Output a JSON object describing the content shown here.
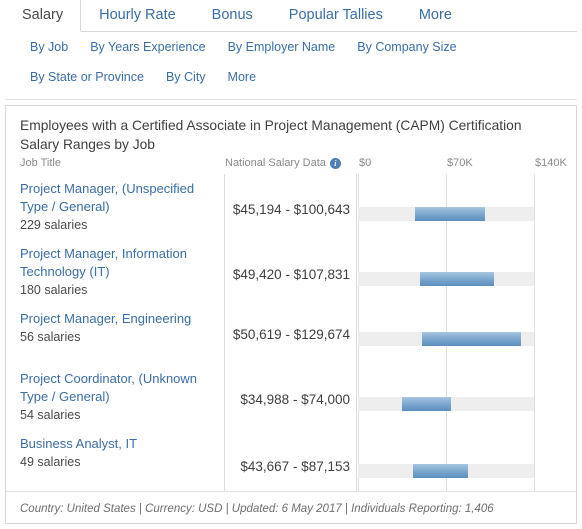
{
  "tabs": [
    {
      "label": "Salary",
      "active": true
    },
    {
      "label": "Hourly Rate",
      "active": false
    },
    {
      "label": "Bonus",
      "active": false
    },
    {
      "label": "Popular Tallies",
      "active": false
    },
    {
      "label": "More",
      "active": false
    }
  ],
  "subnav": {
    "row1": [
      "By Job",
      "By Years Experience",
      "By Employer Name",
      "By Company Size"
    ],
    "row2": [
      "By State or Province",
      "By City",
      "More"
    ]
  },
  "panel": {
    "title": "Employees with a Certified Associate in Project Management (CAPM) Certification Salary Ranges by Job",
    "columns": {
      "job_title": "Job Title",
      "national_salary_data": "National Salary Data",
      "info_icon": "info-icon",
      "info_glyph": "i"
    },
    "footer": "Country: United States  |  Currency: USD  |  Updated: 6 May 2017  |  Individuals Reporting: 1,406"
  },
  "chart_data": {
    "type": "bar",
    "title": "Employees with a Certified Associate in Project Management (CAPM) Certification Salary Ranges by Job",
    "xlabel": "",
    "ylabel": "Job Title",
    "xlim": [
      0,
      140000
    ],
    "ticks": [
      "$0",
      "$70K",
      "$140K"
    ],
    "tick_values": [
      0,
      70000,
      140000
    ],
    "grid": true,
    "legend": false,
    "categories": [
      "Project Manager, (Unspecified Type / General)",
      "Project Manager, Information Technology (IT)",
      "Project Manager, Engineering",
      "Project Coordinator, (Unknown Type / General)",
      "Business Analyst, IT"
    ],
    "series": [
      {
        "name": "Salary low",
        "values": [
          45194,
          49420,
          50619,
          34988,
          43667
        ]
      },
      {
        "name": "Salary high",
        "values": [
          100643,
          107831,
          129674,
          74000,
          87153
        ]
      }
    ],
    "rows": [
      {
        "job_title": "Project Manager, (Unspecified Type / General)",
        "salaries_label": "229 salaries",
        "salary_count": 229,
        "range_label": "$45,194 - $100,643",
        "low": 45194,
        "high": 100643
      },
      {
        "job_title": "Project Manager, Information Technology (IT)",
        "salaries_label": "180 salaries",
        "salary_count": 180,
        "range_label": "$49,420 - $107,831",
        "low": 49420,
        "high": 107831
      },
      {
        "job_title": "Project Manager, Engineering",
        "salaries_label": "56 salaries",
        "salary_count": 56,
        "range_label": "$50,619 - $129,674",
        "low": 50619,
        "high": 129674
      },
      {
        "job_title": "Project Coordinator, (Unknown Type / General)",
        "salaries_label": "54 salaries",
        "salary_count": 54,
        "range_label": "$34,988 - $74,000",
        "low": 34988,
        "high": 74000
      },
      {
        "job_title": "Business Analyst, IT",
        "salaries_label": "49 salaries",
        "salary_count": 49,
        "range_label": "$43,667 - $87,153",
        "low": 43667,
        "high": 87153
      }
    ]
  },
  "colors": {
    "link": "#3a6ea5",
    "bar_fill": "#6b9ac6",
    "bar_track": "#eeeeee",
    "border": "#d8d8d8",
    "info_badge": "#4e7fb5"
  }
}
